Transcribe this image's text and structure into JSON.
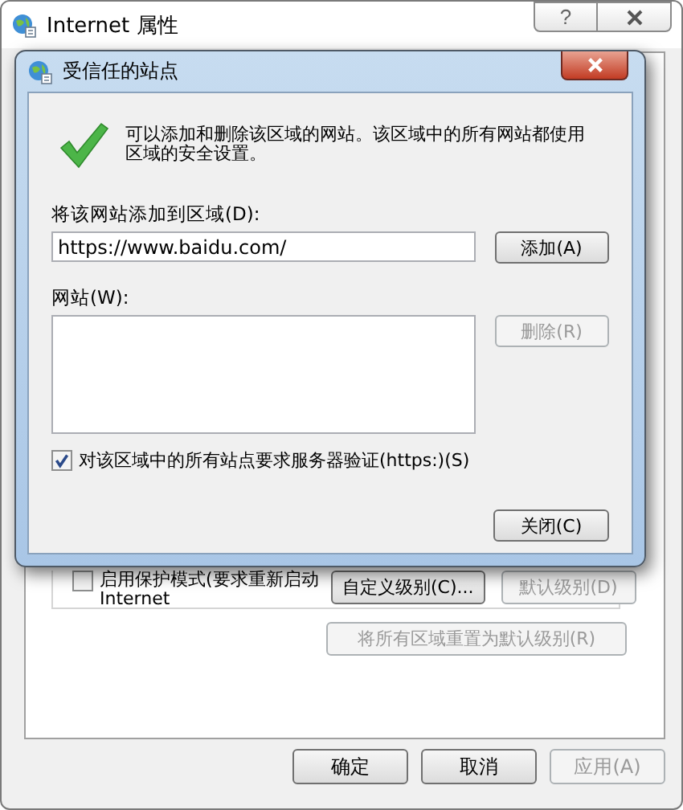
{
  "window": {
    "title": "Internet 属性",
    "help_label": "?"
  },
  "protected_mode": {
    "label": "启用保护模式(要求重新启动 Internet",
    "checked": false
  },
  "level_buttons": [
    {
      "label": "自定义级别(C)...",
      "disabled": false
    },
    {
      "label": "默认级别(D)",
      "disabled": true
    }
  ],
  "reset_button": {
    "label": "将所有区域重置为默认级别(R)",
    "disabled": true
  },
  "footer_buttons": [
    {
      "label": "确定",
      "disabled": false
    },
    {
      "label": "取消",
      "disabled": false
    },
    {
      "label": "应用(A)",
      "disabled": true
    }
  ],
  "dialog": {
    "title": "受信任的站点",
    "message": "可以添加和删除该区域的网站。该区域中的所有网站都使用区域的安全设置。",
    "add_label": "将该网站添加到区域(D):",
    "url_value": "https://www.baidu.com/",
    "add_button": {
      "label": "添加(A)",
      "disabled": false
    },
    "sites_label": "网站(W):",
    "remove_button": {
      "label": "删除(R)",
      "disabled": true
    },
    "require_https": {
      "label": "对该区域中的所有站点要求服务器验证(https:)(S)",
      "checked": true
    },
    "close_button": {
      "label": "关闭(C)",
      "disabled": false
    }
  }
}
